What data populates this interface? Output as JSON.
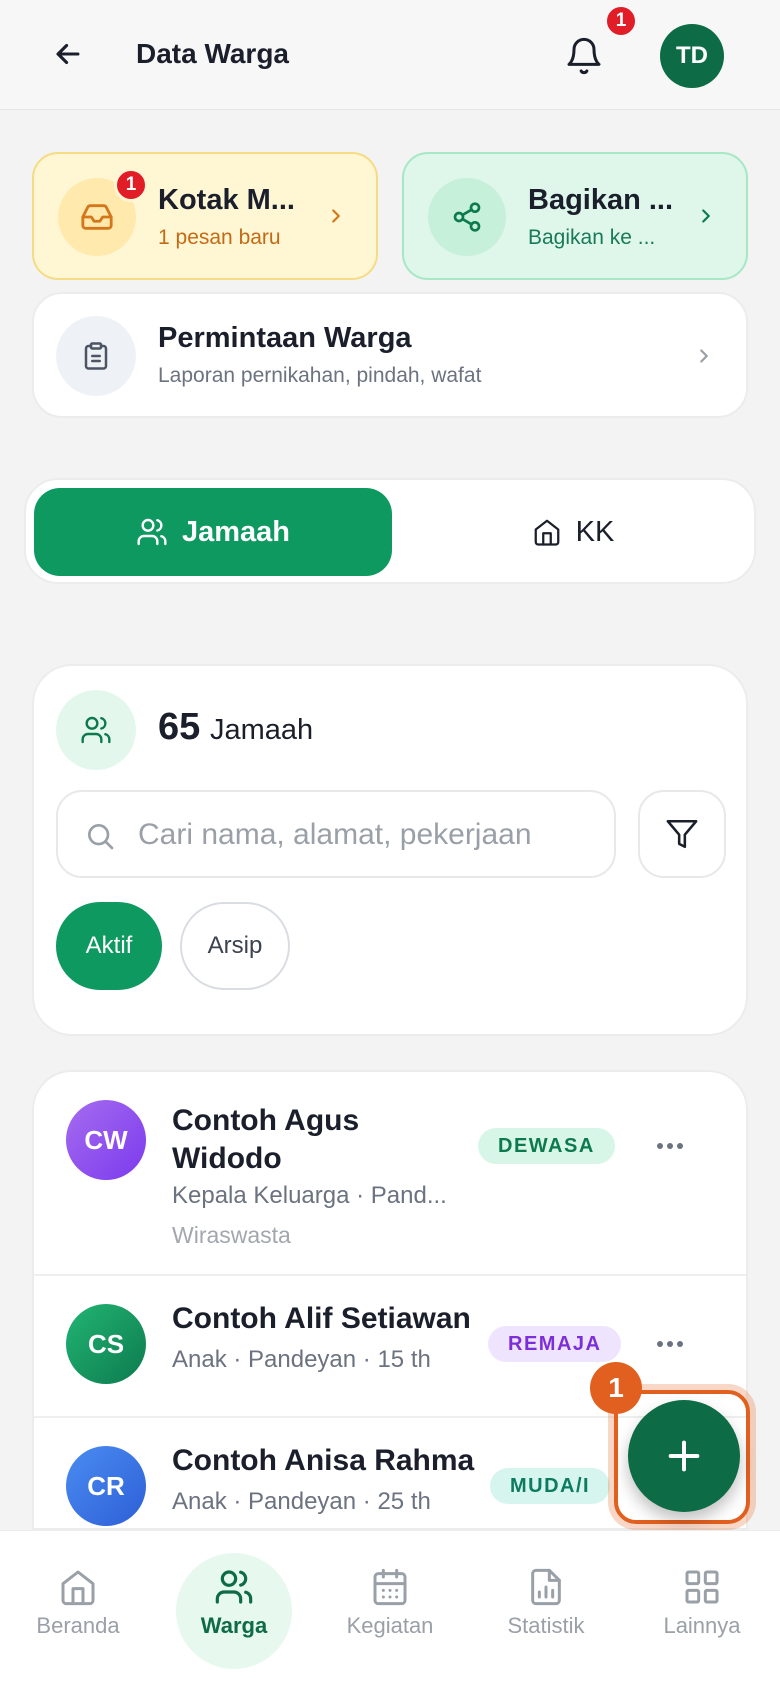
{
  "header": {
    "title": "Data Warga",
    "notification_count": "1",
    "avatar_initials": "TD"
  },
  "quick_cards": {
    "inbox": {
      "title": "Kotak M...",
      "subtitle": "1 pesan baru",
      "badge": "1"
    },
    "share": {
      "title": "Bagikan ...",
      "subtitle": "Bagikan ke ..."
    }
  },
  "request_card": {
    "title": "Permintaan Warga",
    "subtitle": "Laporan pernikahan, pindah, wafat"
  },
  "tabs": {
    "jamaah": "Jamaah",
    "kk": "KK",
    "active": "jamaah"
  },
  "summary": {
    "count": "65",
    "label": "Jamaah",
    "search_placeholder": "Cari nama, alamat, pekerjaan",
    "chips": {
      "active": "Aktif",
      "archive": "Arsip"
    }
  },
  "members": [
    {
      "initials": "CW",
      "name": "Contoh Agus Widodo",
      "meta": "Kepala Keluarga · Pand...",
      "job": "Wiraswasta",
      "badge": "DEWASA"
    },
    {
      "initials": "CS",
      "name": "Contoh Alif Setiawan",
      "meta": "Anak · Pandeyan · 15 th",
      "badge": "REMAJA"
    },
    {
      "initials": "CR",
      "name": "Contoh Anisa Rahma",
      "meta": "Anak · Pandeyan · 25 th",
      "badge": "MUDA/I"
    }
  ],
  "fab": {
    "step_number": "1"
  },
  "bottom_nav": {
    "home": "Beranda",
    "warga": "Warga",
    "kegiatan": "Kegiatan",
    "statistik": "Statistik",
    "lainnya": "Lainnya",
    "active": "warga"
  },
  "colors": {
    "primary": "#0d9960",
    "primary_dark": "#0d6b45",
    "badge_red": "#e11d28",
    "highlight_orange": "#e2601f"
  }
}
